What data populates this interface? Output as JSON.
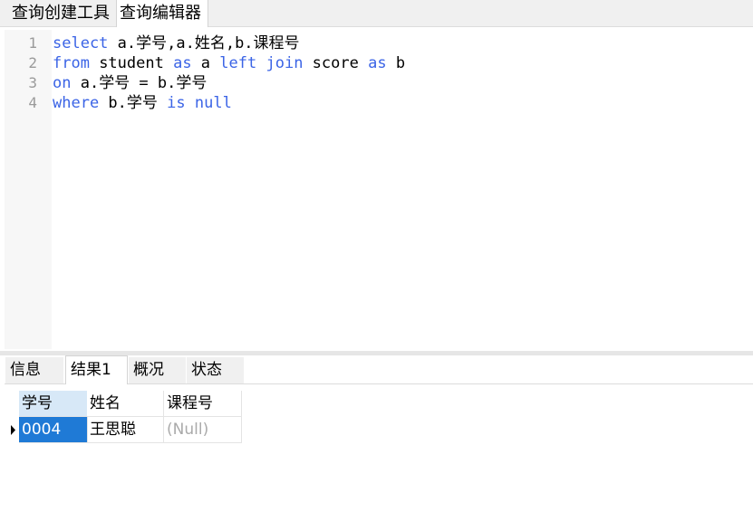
{
  "top_tabs": [
    {
      "label": "查询创建工具",
      "active": false
    },
    {
      "label": "查询编辑器",
      "active": true
    }
  ],
  "editor": {
    "lines": [
      {
        "num": "1",
        "tokens": [
          {
            "t": "select",
            "kw": true
          },
          {
            "t": " a.学号,a.姓名,b.课程号",
            "kw": false
          }
        ]
      },
      {
        "num": "2",
        "tokens": [
          {
            "t": "from",
            "kw": true
          },
          {
            "t": " student ",
            "kw": false
          },
          {
            "t": "as",
            "kw": true
          },
          {
            "t": " a ",
            "kw": false
          },
          {
            "t": "left",
            "kw": true
          },
          {
            "t": " ",
            "kw": false
          },
          {
            "t": "join",
            "kw": true
          },
          {
            "t": " score ",
            "kw": false
          },
          {
            "t": "as",
            "kw": true
          },
          {
            "t": " b",
            "kw": false
          }
        ]
      },
      {
        "num": "3",
        "tokens": [
          {
            "t": "on",
            "kw": true
          },
          {
            "t": " a.学号 = b.学号",
            "kw": false
          }
        ]
      },
      {
        "num": "4",
        "tokens": [
          {
            "t": "where",
            "kw": true
          },
          {
            "t": " b.学号 ",
            "kw": false
          },
          {
            "t": "is",
            "kw": true
          },
          {
            "t": " ",
            "kw": false
          },
          {
            "t": "null",
            "kw": true
          }
        ]
      }
    ]
  },
  "result_tabs": [
    {
      "label": "信息",
      "active": false
    },
    {
      "label": "结果1",
      "active": true
    },
    {
      "label": "概况",
      "active": false
    },
    {
      "label": "状态",
      "active": false
    }
  ],
  "grid": {
    "columns": [
      "学号",
      "姓名",
      "课程号"
    ],
    "rows": [
      [
        "0004",
        "王思聪",
        "(Null)"
      ]
    ]
  }
}
